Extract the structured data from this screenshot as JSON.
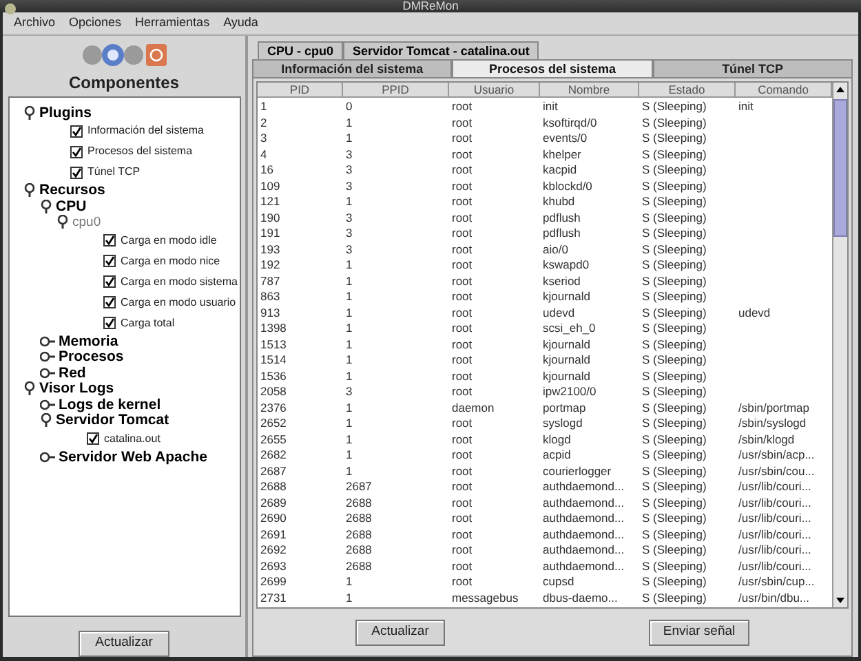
{
  "window": {
    "title": "DMReMon"
  },
  "menu": [
    "Archivo",
    "Opciones",
    "Herramientas",
    "Ayuda"
  ],
  "sidebar": {
    "title": "Componentes",
    "button": "Actualizar",
    "tree": [
      {
        "label": "Plugins",
        "kind": "group",
        "expanded": true,
        "children": [
          {
            "label": "Información del sistema",
            "kind": "check",
            "checked": true
          },
          {
            "label": "Procesos del sistema",
            "kind": "check",
            "checked": true
          },
          {
            "label": "Túnel TCP",
            "kind": "check",
            "checked": true
          }
        ]
      },
      {
        "label": "Recursos",
        "kind": "group",
        "expanded": true,
        "children": [
          {
            "label": "CPU",
            "kind": "group",
            "expanded": true,
            "children": [
              {
                "label": "cpu0",
                "kind": "instance",
                "expanded": true,
                "children": [
                  {
                    "label": "Carga en modo idle",
                    "kind": "check",
                    "checked": true
                  },
                  {
                    "label": "Carga en modo nice",
                    "kind": "check",
                    "checked": true
                  },
                  {
                    "label": "Carga en modo sistema",
                    "kind": "check",
                    "checked": true
                  },
                  {
                    "label": "Carga en modo usuario",
                    "kind": "check",
                    "checked": true
                  },
                  {
                    "label": "Carga total",
                    "kind": "check",
                    "checked": true
                  }
                ]
              }
            ]
          },
          {
            "label": "Memoria",
            "kind": "group",
            "expanded": false
          },
          {
            "label": "Procesos",
            "kind": "group",
            "expanded": false
          },
          {
            "label": "Red",
            "kind": "group",
            "expanded": false
          }
        ]
      },
      {
        "label": "Visor Logs",
        "kind": "group",
        "expanded": true,
        "children": [
          {
            "label": "Logs de kernel",
            "kind": "group",
            "expanded": false
          },
          {
            "label": "Servidor Tomcat",
            "kind": "group",
            "expanded": true,
            "children": [
              {
                "label": "catalina.out",
                "kind": "check",
                "checked": true
              }
            ]
          },
          {
            "label": "Servidor Web Apache",
            "kind": "group",
            "expanded": false
          }
        ]
      }
    ]
  },
  "tab_rows": [
    [
      {
        "label": "CPU - cpu0",
        "selected": false
      },
      {
        "label": "Servidor Tomcat - catalina.out",
        "selected": false
      }
    ],
    [
      {
        "label": "Información del sistema",
        "selected": false
      },
      {
        "label": "Procesos del sistema",
        "selected": true
      },
      {
        "label": "Túnel TCP",
        "selected": false
      }
    ]
  ],
  "table": {
    "columns": [
      "PID",
      "PPID",
      "Usuario",
      "Nombre",
      "Estado",
      "Comando"
    ],
    "rows": [
      [
        "1",
        "0",
        "root",
        "init",
        "S (Sleeping)",
        "init"
      ],
      [
        "2",
        "1",
        "root",
        "ksoftirqd/0",
        "S (Sleeping)",
        ""
      ],
      [
        "3",
        "1",
        "root",
        "events/0",
        "S (Sleeping)",
        ""
      ],
      [
        "4",
        "3",
        "root",
        "khelper",
        "S (Sleeping)",
        ""
      ],
      [
        "16",
        "3",
        "root",
        "kacpid",
        "S (Sleeping)",
        ""
      ],
      [
        "109",
        "3",
        "root",
        "kblockd/0",
        "S (Sleeping)",
        ""
      ],
      [
        "121",
        "1",
        "root",
        "khubd",
        "S (Sleeping)",
        ""
      ],
      [
        "190",
        "3",
        "root",
        "pdflush",
        "S (Sleeping)",
        ""
      ],
      [
        "191",
        "3",
        "root",
        "pdflush",
        "S (Sleeping)",
        ""
      ],
      [
        "193",
        "3",
        "root",
        "aio/0",
        "S (Sleeping)",
        ""
      ],
      [
        "192",
        "1",
        "root",
        "kswapd0",
        "S (Sleeping)",
        ""
      ],
      [
        "787",
        "1",
        "root",
        "kseriod",
        "S (Sleeping)",
        ""
      ],
      [
        "863",
        "1",
        "root",
        "kjournald",
        "S (Sleeping)",
        ""
      ],
      [
        "913",
        "1",
        "root",
        "udevd",
        "S (Sleeping)",
        "udevd"
      ],
      [
        "1398",
        "1",
        "root",
        "scsi_eh_0",
        "S (Sleeping)",
        ""
      ],
      [
        "1513",
        "1",
        "root",
        "kjournald",
        "S (Sleeping)",
        ""
      ],
      [
        "1514",
        "1",
        "root",
        "kjournald",
        "S (Sleeping)",
        ""
      ],
      [
        "1536",
        "1",
        "root",
        "kjournald",
        "S (Sleeping)",
        ""
      ],
      [
        "2058",
        "3",
        "root",
        "ipw2100/0",
        "S (Sleeping)",
        ""
      ],
      [
        "2376",
        "1",
        "daemon",
        "portmap",
        "S (Sleeping)",
        "/sbin/portmap"
      ],
      [
        "2652",
        "1",
        "root",
        "syslogd",
        "S (Sleeping)",
        "/sbin/syslogd"
      ],
      [
        "2655",
        "1",
        "root",
        "klogd",
        "S (Sleeping)",
        "/sbin/klogd"
      ],
      [
        "2682",
        "1",
        "root",
        "acpid",
        "S (Sleeping)",
        "/usr/sbin/acp..."
      ],
      [
        "2687",
        "1",
        "root",
        "courierlogger",
        "S (Sleeping)",
        "/usr/sbin/cou..."
      ],
      [
        "2688",
        "2687",
        "root",
        "authdaemond...",
        "S (Sleeping)",
        "/usr/lib/couri..."
      ],
      [
        "2689",
        "2688",
        "root",
        "authdaemond...",
        "S (Sleeping)",
        "/usr/lib/couri..."
      ],
      [
        "2690",
        "2688",
        "root",
        "authdaemond...",
        "S (Sleeping)",
        "/usr/lib/couri..."
      ],
      [
        "2691",
        "2688",
        "root",
        "authdaemond...",
        "S (Sleeping)",
        "/usr/lib/couri..."
      ],
      [
        "2692",
        "2688",
        "root",
        "authdaemond...",
        "S (Sleeping)",
        "/usr/lib/couri..."
      ],
      [
        "2693",
        "2688",
        "root",
        "authdaemond...",
        "S (Sleeping)",
        "/usr/lib/couri..."
      ],
      [
        "2699",
        "1",
        "root",
        "cupsd",
        "S (Sleeping)",
        "/usr/sbin/cup..."
      ],
      [
        "2731",
        "1",
        "messagebus",
        "dbus-daemo...",
        "S (Sleeping)",
        "/usr/bin/dbu..."
      ]
    ]
  },
  "buttons": [
    "Actualizar",
    "Enviar señal"
  ]
}
